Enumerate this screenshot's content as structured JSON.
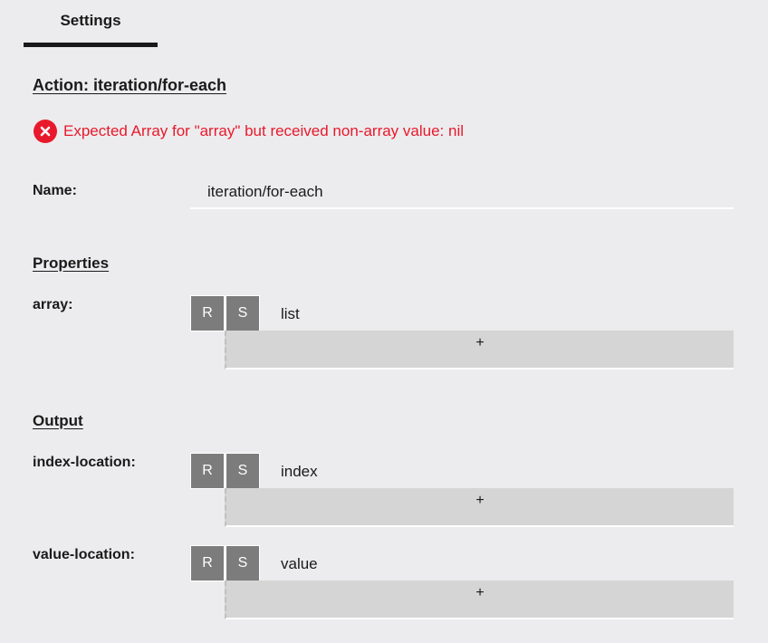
{
  "tabs": {
    "settings_label": "Settings"
  },
  "action": {
    "title": "Action: iteration/for-each"
  },
  "error": {
    "message": "Expected Array for \"array\" but received non-array value: nil",
    "color": "#e8192c"
  },
  "name_field": {
    "label": "Name:",
    "value": "iteration/for-each"
  },
  "properties": {
    "heading": "Properties",
    "array": {
      "label": "array:",
      "r_label": "R",
      "s_label": "S",
      "value": "list",
      "add_label": "+"
    }
  },
  "output": {
    "heading": "Output",
    "index_location": {
      "label": "index-location:",
      "r_label": "R",
      "s_label": "S",
      "value": "index",
      "add_label": "+"
    },
    "value_location": {
      "label": "value-location:",
      "r_label": "R",
      "s_label": "S",
      "value": "value",
      "add_label": "+"
    }
  }
}
